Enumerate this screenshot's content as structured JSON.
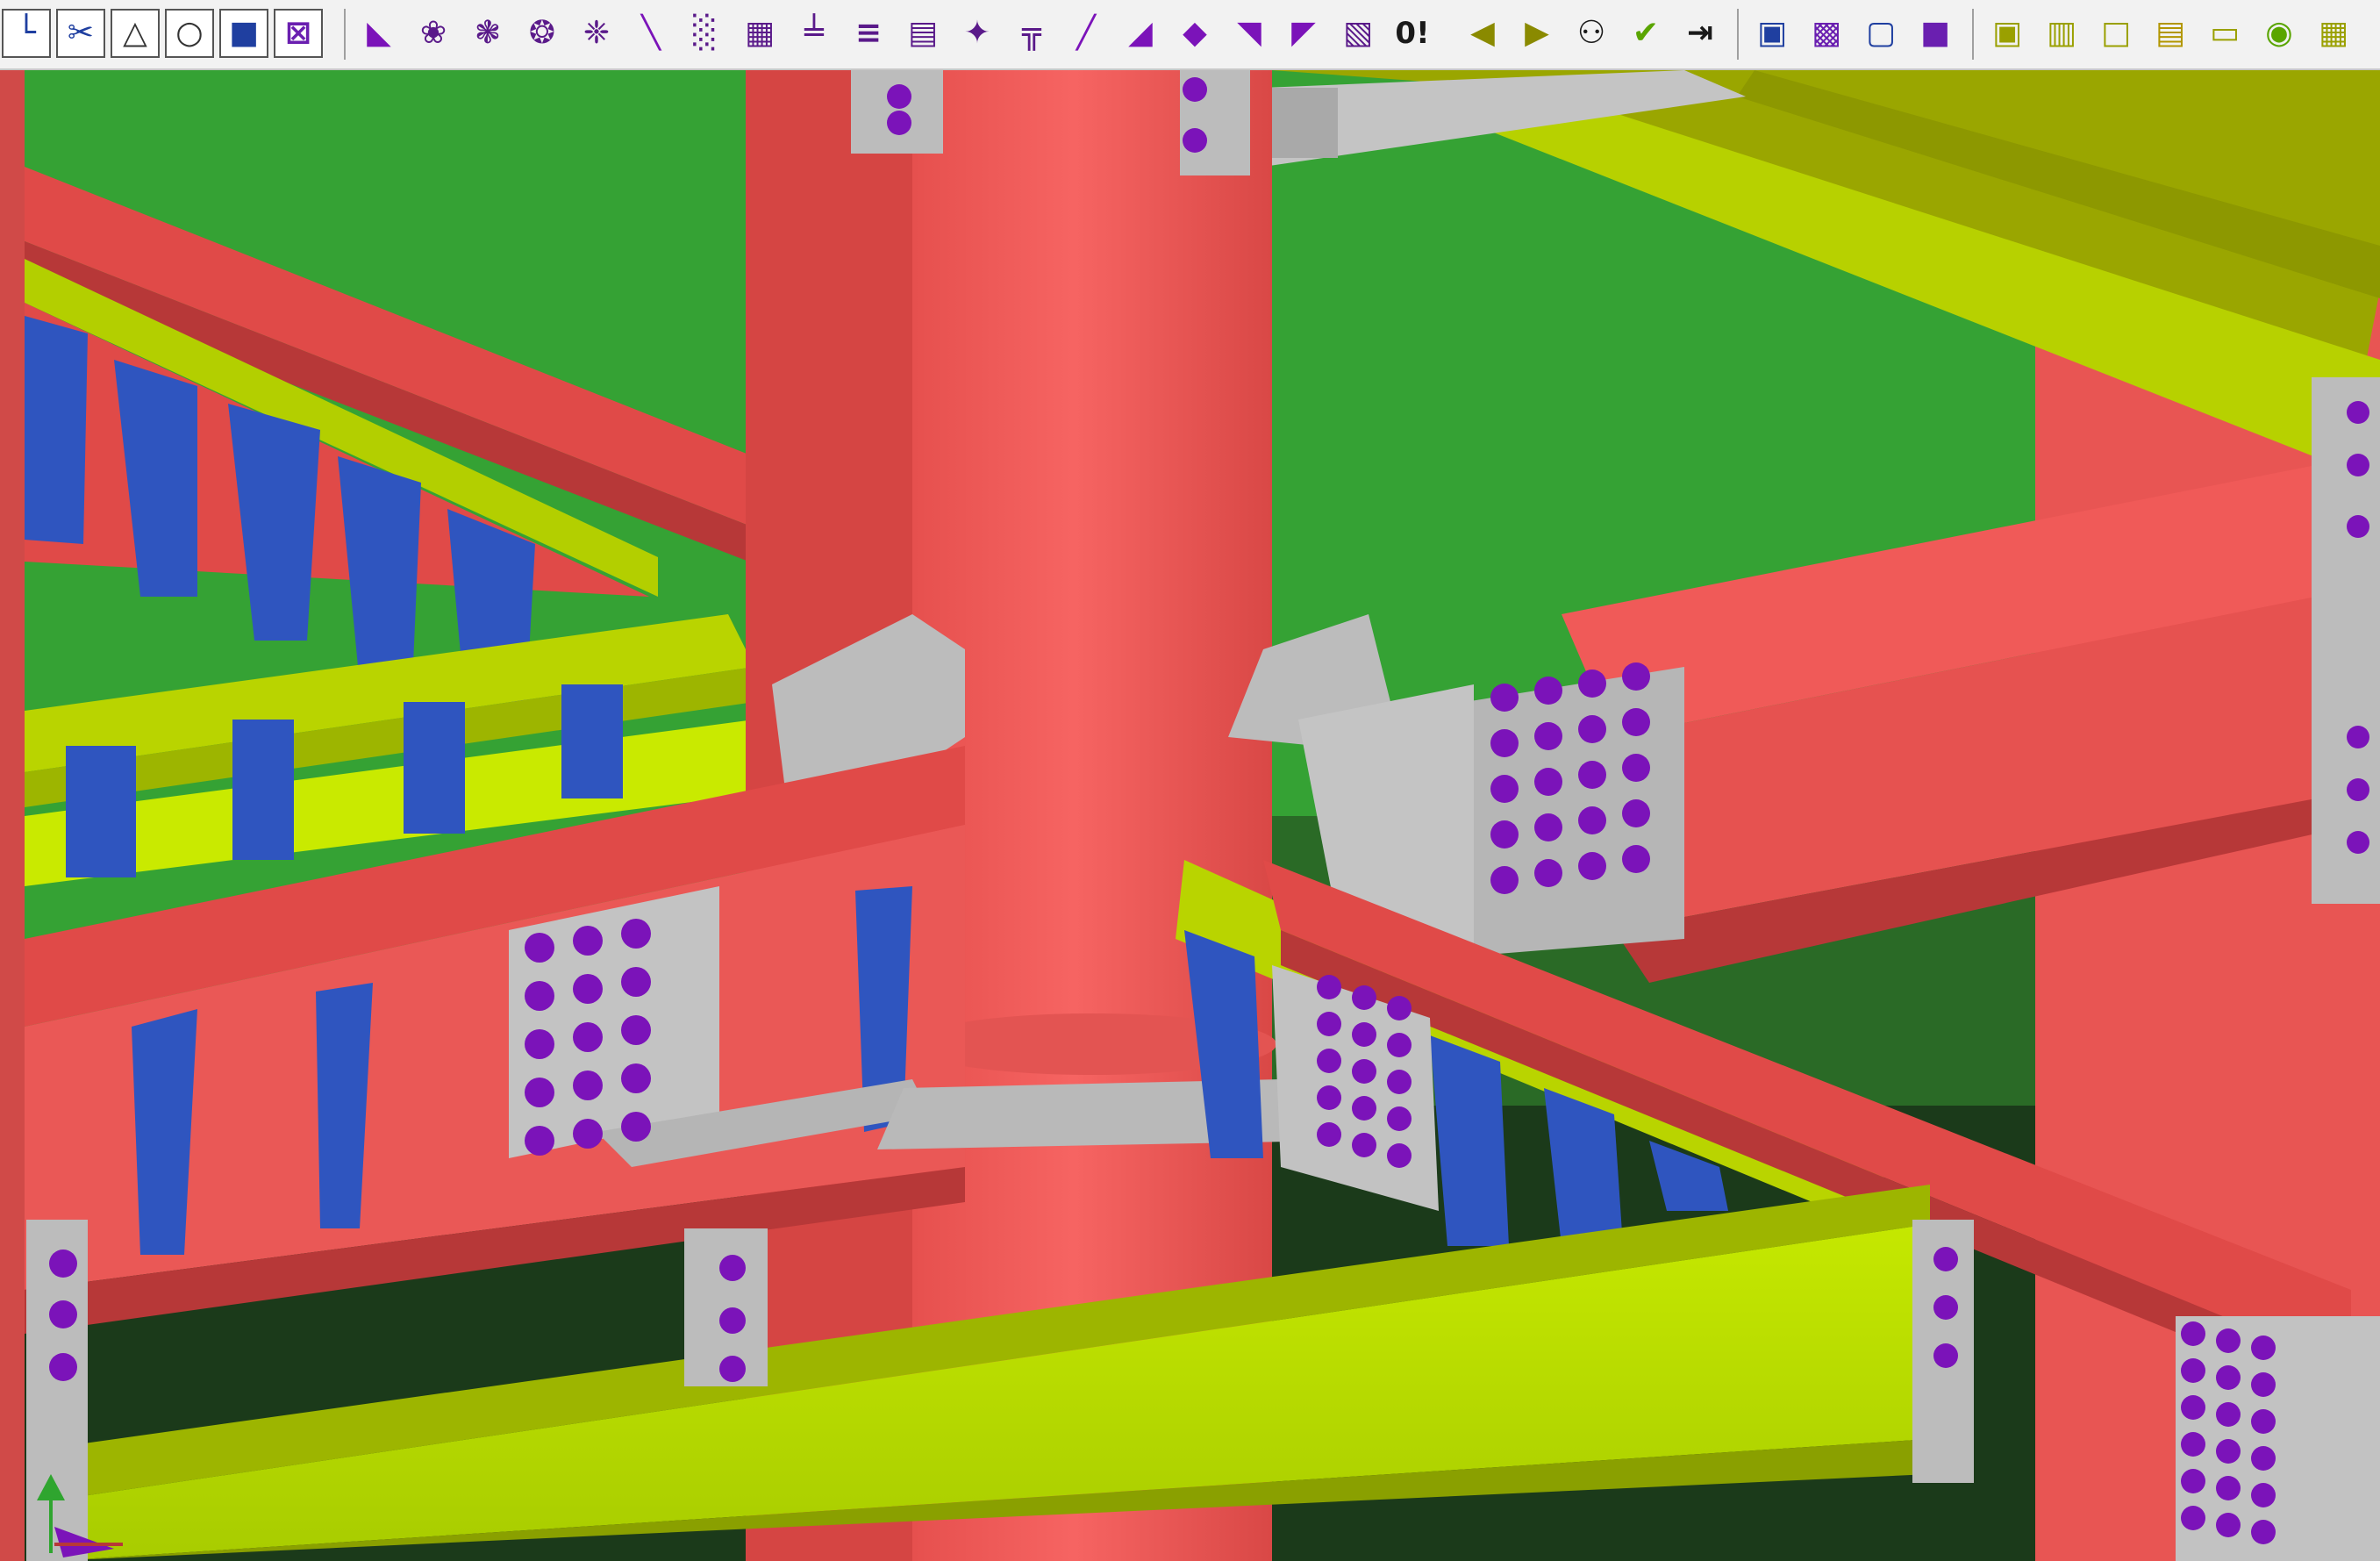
{
  "colors": {
    "background": "#35a234",
    "background_dark": "#1b3a1a",
    "column": "#f05a58",
    "column_dark": "#b93a3b",
    "beam_yellow": "#b6d900",
    "beam_olive": "#97a400",
    "plate": "#bcbcbc",
    "bolt": "#7b13b9",
    "stiffener": "#2f55bf",
    "toolbar": "#f2f2f2"
  },
  "toolbar": {
    "view_buttons": [
      {
        "name": "ucs-icon",
        "glyph": "└",
        "color": "#1f3fa0"
      },
      {
        "name": "scissors-icon",
        "glyph": "✂",
        "color": "#1f3fa0"
      },
      {
        "name": "triangle-icon",
        "glyph": "△",
        "color": "#333333"
      },
      {
        "name": "circle-icon",
        "glyph": "○",
        "color": "#333333"
      },
      {
        "name": "square-icon",
        "glyph": "■",
        "color": "#1f3fa0"
      },
      {
        "name": "grid-select-icon",
        "glyph": "⊠",
        "color": "#6a1fb0"
      }
    ],
    "steel_tools": [
      {
        "name": "bent-plate-icon",
        "glyph": "◣",
        "color": "#7b13b9"
      },
      {
        "name": "weld-icon",
        "glyph": "❀",
        "color": "#5a1a8a"
      },
      {
        "name": "bolt-group-icon",
        "glyph": "❃",
        "color": "#5a1a8a"
      },
      {
        "name": "hole-icon",
        "glyph": "❂",
        "color": "#5a1a8a"
      },
      {
        "name": "anchor-icon",
        "glyph": "❈",
        "color": "#5a1a8a"
      },
      {
        "name": "line-tool-icon",
        "glyph": "╲",
        "color": "#7b13b9"
      },
      {
        "name": "beam-series-icon",
        "glyph": "░",
        "color": "#5a1a8a"
      },
      {
        "name": "grating-icon",
        "glyph": "▦",
        "color": "#5a1a8a"
      },
      {
        "name": "stair-stringer-icon",
        "glyph": "╧",
        "color": "#5a1a8a"
      },
      {
        "name": "ladder-icon",
        "glyph": "≡",
        "color": "#5a1a8a"
      },
      {
        "name": "cage-icon",
        "glyph": "▤",
        "color": "#5a1a8a"
      },
      {
        "name": "frame-icon",
        "glyph": "✦",
        "color": "#5a1a8a"
      },
      {
        "name": "portal-icon",
        "glyph": "╦",
        "color": "#5a1a8a"
      },
      {
        "name": "purlin-icon",
        "glyph": "╱",
        "color": "#7b13b9"
      },
      {
        "name": "bracing-icon",
        "glyph": "◢",
        "color": "#7b13b9"
      },
      {
        "name": "plate-cut-icon",
        "glyph": "◆",
        "color": "#7b13b9"
      },
      {
        "name": "end-plate-icon",
        "glyph": "◥",
        "color": "#7b13b9"
      },
      {
        "name": "gusset-icon",
        "glyph": "◤",
        "color": "#7b13b9"
      },
      {
        "name": "folded-plate-icon",
        "glyph": "▧",
        "color": "#5a1a8a"
      }
    ],
    "numbering_button": {
      "name": "numbering-icon",
      "label": "0!"
    },
    "nav_buttons": [
      {
        "name": "previous-arrow-icon",
        "glyph": "◀",
        "color": "#8a8a00"
      },
      {
        "name": "next-arrow-icon",
        "glyph": "▶",
        "color": "#8a8a00"
      },
      {
        "name": "binoculars-icon",
        "glyph": "⚇",
        "color": "#1a1a1a"
      },
      {
        "name": "check-icon",
        "glyph": "✔",
        "color": "#5aa500"
      },
      {
        "name": "arrow-into-bar-icon",
        "glyph": "⇥",
        "color": "#1a1a1a"
      }
    ],
    "window_buttons": [
      {
        "name": "view-box-icon",
        "glyph": "▣",
        "color": "#1f3fa0"
      },
      {
        "name": "layers-icon",
        "glyph": "▩",
        "color": "#6a1fb0"
      },
      {
        "name": "zoom-extents-icon",
        "glyph": "▢",
        "color": "#1f3fa0"
      },
      {
        "name": "solid-view-icon",
        "glyph": "■",
        "color": "#6a1fb0"
      }
    ],
    "doc_buttons": [
      {
        "name": "drawing-icon",
        "glyph": "▣",
        "color": "#9aa000"
      },
      {
        "name": "sheet-set-icon",
        "glyph": "▥",
        "color": "#9aa000"
      },
      {
        "name": "single-sheet-icon",
        "glyph": "□",
        "color": "#9aa000"
      },
      {
        "name": "list-icon",
        "glyph": "▤",
        "color": "#b29600"
      },
      {
        "name": "panel-icon",
        "glyph": "▭",
        "color": "#9aa000"
      },
      {
        "name": "detail-icon",
        "glyph": "◉",
        "color": "#5aa500"
      },
      {
        "name": "overflow-icon",
        "glyph": "▦",
        "color": "#9aa000"
      }
    ]
  }
}
